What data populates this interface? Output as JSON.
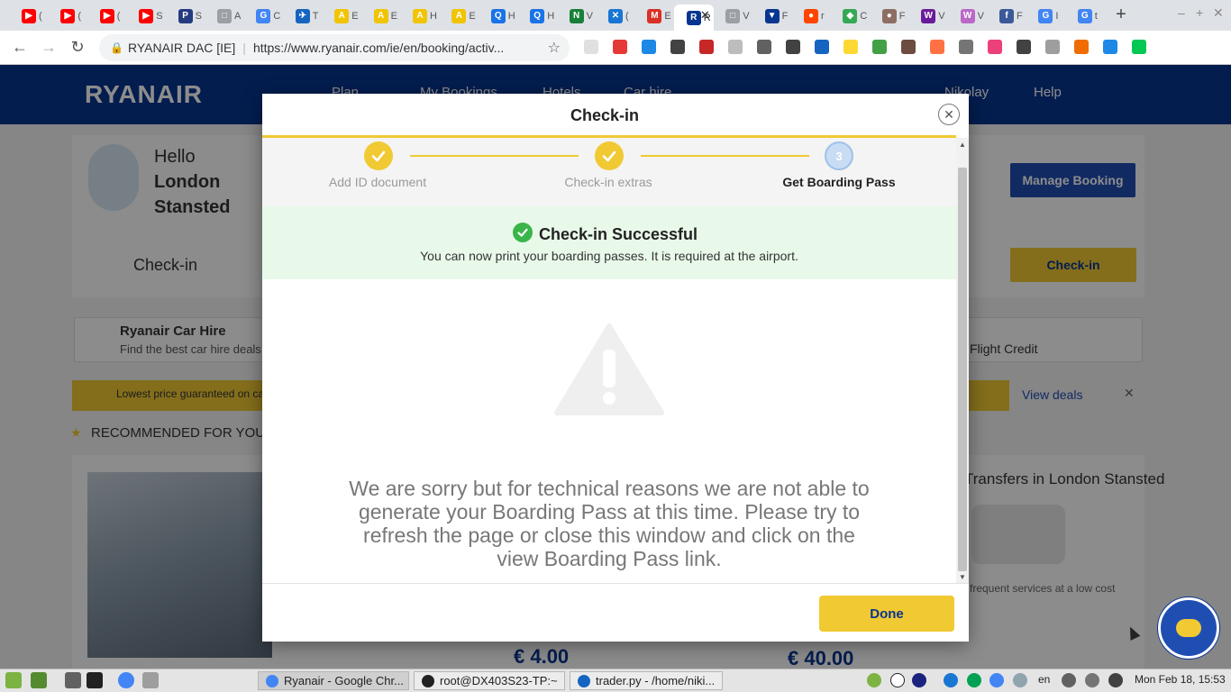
{
  "browser": {
    "tabs": [
      {
        "label": "(",
        "color": "#ff0000",
        "glyph": "▶"
      },
      {
        "label": "(",
        "color": "#ff0000",
        "glyph": "▶"
      },
      {
        "label": "(",
        "color": "#ff0000",
        "glyph": "▶"
      },
      {
        "label": "S",
        "color": "#ff0000",
        "glyph": "▶"
      },
      {
        "label": "S",
        "color": "#253b80",
        "glyph": "P"
      },
      {
        "label": "A",
        "color": "#9aa0a6",
        "glyph": "□"
      },
      {
        "label": "C",
        "color": "#4285f4",
        "glyph": "G"
      },
      {
        "label": "T",
        "color": "#1565c0",
        "glyph": "✈"
      },
      {
        "label": "E",
        "color": "#f1c400",
        "glyph": "A"
      },
      {
        "label": "E",
        "color": "#f1c400",
        "glyph": "A"
      },
      {
        "label": "H",
        "color": "#f1c400",
        "glyph": "A"
      },
      {
        "label": "E",
        "color": "#f1c400",
        "glyph": "A"
      },
      {
        "label": "H",
        "color": "#1a73e8",
        "glyph": "Q"
      },
      {
        "label": "H",
        "color": "#1a73e8",
        "glyph": "Q"
      },
      {
        "label": "V",
        "color": "#188038",
        "glyph": "N"
      },
      {
        "label": "(",
        "color": "#1976d2",
        "glyph": "✕"
      },
      {
        "label": "E",
        "color": "#d93025",
        "glyph": "M"
      },
      {
        "label": "R",
        "color": "#073590",
        "glyph": "R",
        "active": true
      },
      {
        "label": "V",
        "color": "#9aa0a6",
        "glyph": "□"
      },
      {
        "label": "F",
        "color": "#073590",
        "glyph": "▼"
      },
      {
        "label": "r",
        "color": "#ff4500",
        "glyph": "●"
      },
      {
        "label": "C",
        "color": "#34a853",
        "glyph": "◆"
      },
      {
        "label": "F",
        "color": "#8d6e63",
        "glyph": "●"
      },
      {
        "label": "V",
        "color": "#6a1b9a",
        "glyph": "W"
      },
      {
        "label": "V",
        "color": "#ba68c8",
        "glyph": "W"
      },
      {
        "label": "F",
        "color": "#3b5998",
        "glyph": "f"
      },
      {
        "label": "I",
        "color": "#4285f4",
        "glyph": "G"
      },
      {
        "label": "t",
        "color": "#4285f4",
        "glyph": "G"
      }
    ],
    "active_tab_close": "✕",
    "new_tab": "+",
    "window_controls": [
      "–",
      "+",
      "✕"
    ],
    "omnibox": {
      "org": "RYANAIR DAC [IE]",
      "url": "https://www.ryanair.com/ie/en/booking/activ..."
    },
    "extensions": [
      "#e0e0e0",
      "#e53935",
      "#1e88e5",
      "#424242",
      "#c62828",
      "#bdbdbd",
      "#616161",
      "#424242",
      "#1565c0",
      "#fdd835",
      "#43a047",
      "#6d4c41",
      "#ff7043",
      "#757575",
      "#ec407a",
      "#424242",
      "#9e9e9e",
      "#ef6c00",
      "#1e88e5",
      "#00c853"
    ]
  },
  "site": {
    "logo": "RYANAIR",
    "nav": [
      "Plan",
      "My Bookings",
      "Hotels",
      "Car hire"
    ],
    "user": "Nikolay",
    "help": "Help",
    "hello": "Hello",
    "city": "London Stansted",
    "manage_booking": "Manage Booking",
    "checkin_label": "Check-in",
    "checkin_button": "Check-in",
    "car_hire_title": "Ryanair Car Hire",
    "car_hire_sub": "Find the best car hire deals",
    "flight_credit": "Flight Credit",
    "promo": "Lowest price guaranteed on car hire",
    "view_deals": "View deals",
    "recommended": "RECOMMENDED FOR YOU",
    "transfers": "Transfers in London Stansted",
    "frequent": "frequent services at a low cost",
    "price_1": "€ 4.00",
    "price_2": "€ 40.00"
  },
  "modal": {
    "title": "Check-in",
    "close_glyph": "✕",
    "steps": [
      {
        "label": "Add ID document",
        "state": "done"
      },
      {
        "label": "Check-in extras",
        "state": "done"
      },
      {
        "label": "Get Boarding Pass",
        "state": "current",
        "number": "3"
      }
    ],
    "success_title": "Check-in Successful",
    "success_message": "You can now print your boarding passes. It is required at the airport.",
    "error_message": "We are sorry but for technical reasons we are not able to generate your Boarding Pass at this time. Please try to refresh the page or close this window and click on the view Boarding Pass link.",
    "done_button": "Done"
  },
  "taskbar": {
    "tasks": [
      {
        "label": "Ryanair - Google Chr...",
        "active": true,
        "color": "#4285f4"
      },
      {
        "label": "root@DX403S23-TP:~",
        "active": false,
        "color": "#222222"
      },
      {
        "label": "trader.py - /home/niki...",
        "active": false,
        "color": "#1565c0"
      }
    ],
    "language": "en",
    "clock": "Mon Feb 18, 15:53"
  },
  "colors": {
    "ryanair_blue": "#073590",
    "ryanair_yellow": "#f1c933",
    "success_green": "#3ab54a"
  }
}
